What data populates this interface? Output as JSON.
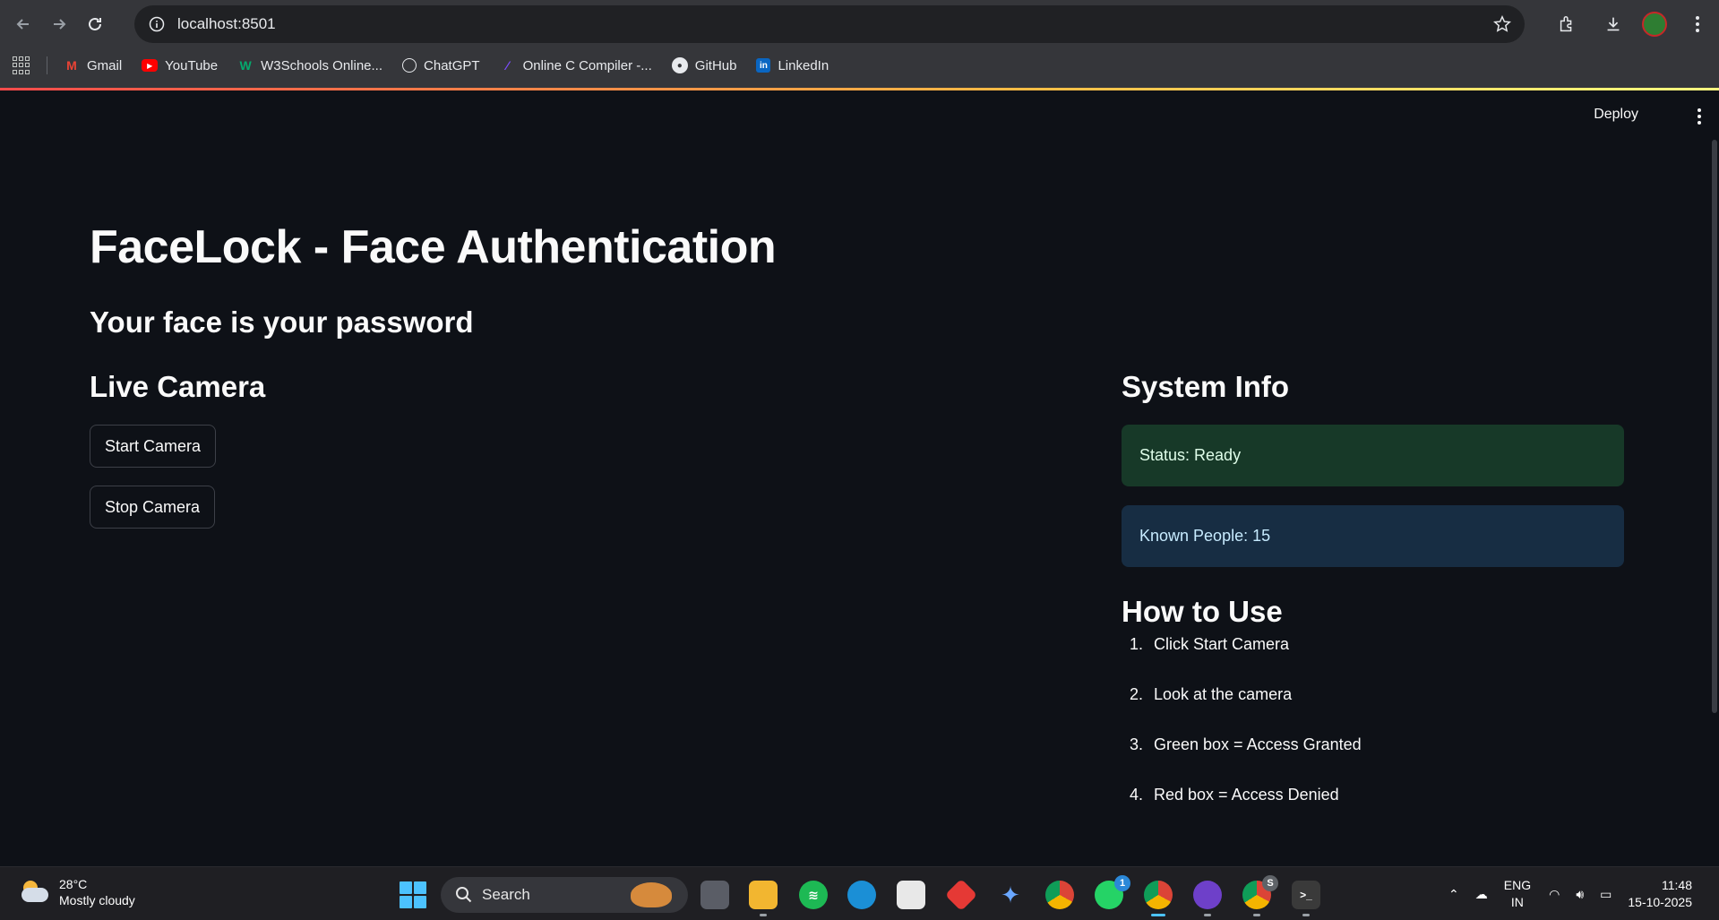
{
  "browser": {
    "url": "localhost:8501",
    "bookmarks": [
      {
        "label": "Gmail",
        "icon": "gmail-icon",
        "color": "#ea4335"
      },
      {
        "label": "YouTube",
        "icon": "youtube-icon",
        "color": "#ff0000"
      },
      {
        "label": "W3Schools Online...",
        "icon": "w3schools-icon",
        "color": "#04aa6d"
      },
      {
        "label": "ChatGPT",
        "icon": "chatgpt-icon",
        "color": "#e8eaed"
      },
      {
        "label": "Online C Compiler -...",
        "icon": "compiler-icon",
        "color": "#7c4dff"
      },
      {
        "label": "GitHub",
        "icon": "github-icon",
        "color": "#e8eaed"
      },
      {
        "label": "LinkedIn",
        "icon": "linkedin-icon",
        "color": "#0a66c2"
      }
    ]
  },
  "header": {
    "deploy_label": "Deploy"
  },
  "main": {
    "title": "FaceLock - Face Authentication",
    "subtitle": "Your face is your password",
    "camera": {
      "heading": "Live Camera",
      "start_label": "Start Camera",
      "stop_label": "Stop Camera"
    },
    "system": {
      "heading": "System Info",
      "status": "Status: Ready",
      "known": "Known People: 15"
    },
    "howto": {
      "heading": "How to Use",
      "steps": [
        {
          "num": "1.",
          "text": "Click Start Camera"
        },
        {
          "num": "2.",
          "text": "Look at the camera"
        },
        {
          "num": "3.",
          "text": "Green box = Access Granted"
        },
        {
          "num": "4.",
          "text": "Red box = Access Denied"
        }
      ]
    }
  },
  "taskbar": {
    "temp": "28°C",
    "weather": "Mostly cloudy",
    "search_label": "Search",
    "whatsapp_badge": "1",
    "chrome_badge": "S",
    "lang_top": "ENG",
    "lang_bottom": "IN",
    "time": "11:48",
    "date": "15-10-2025"
  }
}
